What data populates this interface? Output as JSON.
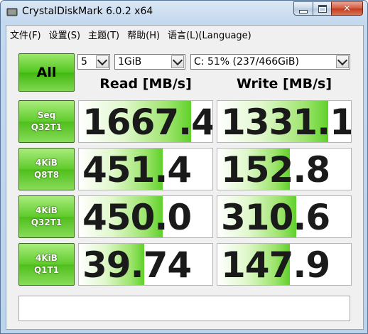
{
  "window": {
    "title": "CrystalDiskMark 6.0.2 x64",
    "icon": "disk-app-icon",
    "controls": [
      "minimize",
      "maximize",
      "close"
    ]
  },
  "menu": [
    "文件(F)",
    "设置(S)",
    "主题(T)",
    "帮助(H)",
    "语言(L)(Language)"
  ],
  "toolbar": {
    "all_label": "All",
    "count": "5",
    "size": "1GiB",
    "drive": "C: 51% (237/466GiB)"
  },
  "headers": {
    "read": "Read [MB/s]",
    "write": "Write [MB/s]"
  },
  "tests": [
    {
      "line1": "Seq",
      "line2": "Q32T1",
      "read": "1667.4",
      "write": "1331.1",
      "read_fill": 0.84,
      "write_fill": 0.83
    },
    {
      "line1": "4KiB",
      "line2": "Q8T8",
      "read": "451.4",
      "write": "152.8",
      "read_fill": 0.63,
      "write_fill": 0.54
    },
    {
      "line1": "4KiB",
      "line2": "Q32T1",
      "read": "450.0",
      "write": "310.6",
      "read_fill": 0.63,
      "write_fill": 0.59
    },
    {
      "line1": "4KiB",
      "line2": "Q1T1",
      "read": "39.74",
      "write": "147.9",
      "read_fill": 0.49,
      "write_fill": 0.54
    }
  ],
  "comment": "",
  "colors": {
    "accent_green": "#4fbf1c",
    "title_bar": "#c4d8ee"
  }
}
